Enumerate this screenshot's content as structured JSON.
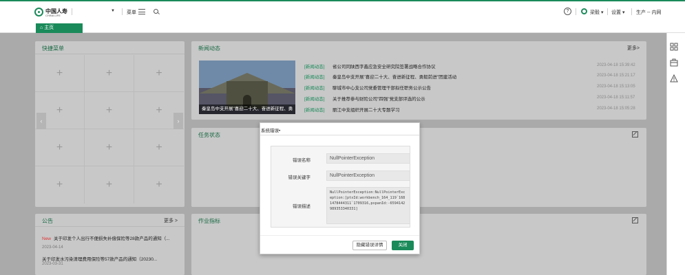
{
  "header": {
    "logo_cn": "中国人寿",
    "logo_en": "CHINA LIFE",
    "menu_label": "菜单",
    "help_glyph": "?",
    "user_name": "梁毅",
    "settings_label": "设置",
    "env_label": "生产 -- 内网"
  },
  "tabs": {
    "home_label": "主页"
  },
  "quick_menu": {
    "title": "快捷菜单",
    "cell_glyph": "+",
    "prev_glyph": "‹",
    "next_glyph": "›"
  },
  "news": {
    "title": "新闻动态",
    "more_label": "更多>",
    "image_caption": "秦皇岛中支开展\"喜迎二十大、奋进新征程、勇",
    "items": [
      {
        "tag": "[新闻动态]",
        "text": "省公司同陕西字鑫应急安全研究院签署战略合作协议",
        "date": "2023-04-18 15:39:42"
      },
      {
        "tag": "[新闻动态]",
        "text": "秦皇岛中支开展\"喜迎二十大、奋进新征程、勇毅前进\"团建活动",
        "date": "2023-04-18 15:21:17"
      },
      {
        "tag": "[新闻动态]",
        "text": "聊城市中心支公司党委管理干部拟任职务公示公告",
        "date": "2023-04-18 15:13:05"
      },
      {
        "tag": "[新闻动态]",
        "text": "关于推荐参与财险公司\"四强\"党支部评选的公示",
        "date": "2023-04-18 15:11:57"
      },
      {
        "tag": "[新闻动态]",
        "text": "丽江中支组织开展二十大专题学习",
        "date": "2023-04-18 15:05:28"
      }
    ]
  },
  "task_status": {
    "title": "任务状态"
  },
  "announcements": {
    "title": "公告",
    "more_label": "更多 >",
    "items": [
      {
        "badge": "New",
        "text": "关于印发个人出行不便损失补偿保险等28款产品的通知（...",
        "date": "2023-04-14"
      },
      {
        "badge": "",
        "text": "关于印发水污染清理费用保险等57款产品的通知（20230...",
        "date": "2023-03-31"
      }
    ]
  },
  "work_metrics": {
    "title": "作业指标"
  },
  "error_dialog": {
    "title": "系统错误•",
    "name_label": "错误名称",
    "name_value": "NullPointerException",
    "keyword_label": "错误关键字",
    "keyword_value": "NullPointerException",
    "desc_label": "错误描述",
    "desc_value": "NullPointerException:NullPointerException:[ptxId:workbench_164_119`1681478444311`1709316,pxpanId:-6594142989353340331]",
    "detail_button": "隐藏错误详情",
    "close_button": "关闭"
  },
  "colors": {
    "brand": "#1a8a5a",
    "overlay": "#aaaaaa"
  }
}
